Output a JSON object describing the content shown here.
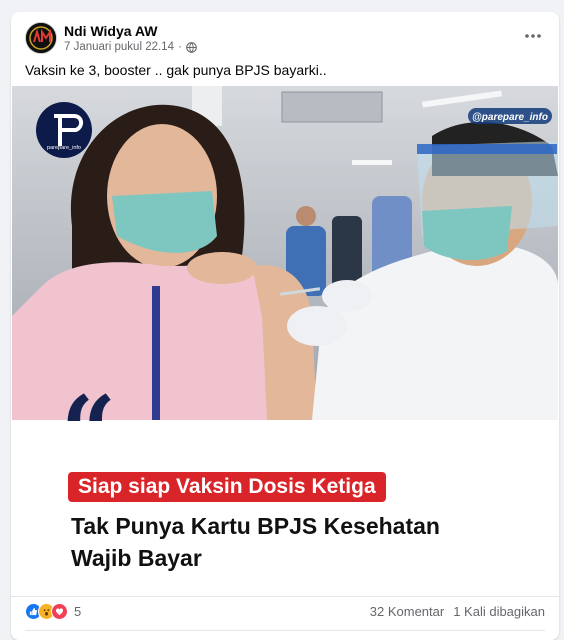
{
  "post": {
    "author": "Ndi Widya AW",
    "timestamp": "7 Januari pukul 22.14",
    "separator": "·",
    "privacy_icon": "globe-icon",
    "caption": "Vaksin ke 3, booster .. gak punya BPJS bayarki.."
  },
  "image": {
    "watermark_handle": "@parepare_info",
    "logo_text": "parepare_info",
    "banner_text": "Siap siap Vaksin Dosis Ketiga",
    "headline": "Tak Punya Kartu BPJS Kesehatan Wajib Bayar",
    "colors": {
      "banner": "#d9252a",
      "quote": "#15224f",
      "logo_bg": "#0d1b4a"
    }
  },
  "stats": {
    "reaction_icons": [
      "like-icon",
      "wow-icon",
      "love-icon"
    ],
    "reaction_count": "5",
    "comments": "32 Komentar",
    "shares": "1 Kali dibagikan"
  }
}
